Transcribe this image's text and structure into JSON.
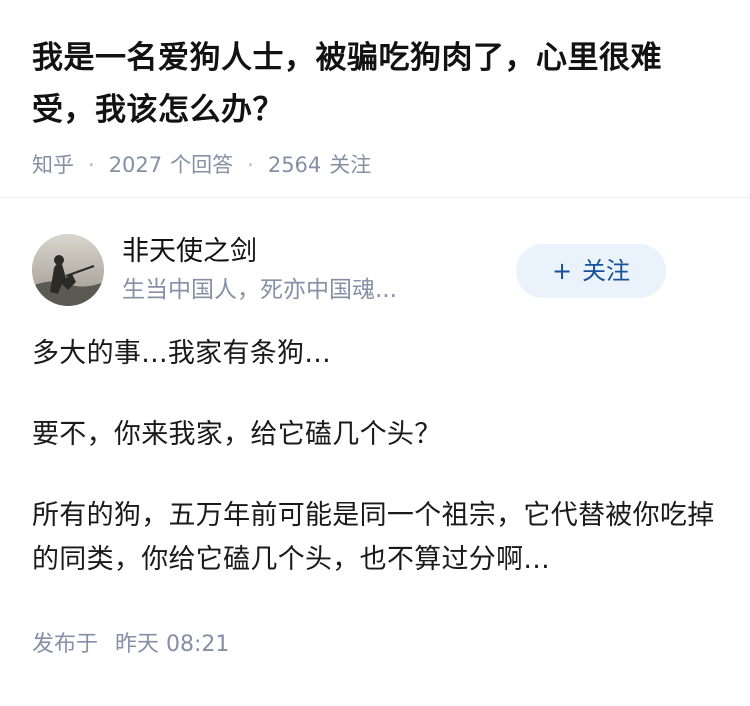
{
  "question": {
    "title": "我是一名爱狗人士，被骗吃狗肉了，心里很难受，我该怎么办？",
    "source": "知乎",
    "answers_count": "2027",
    "answers_label": "个回答",
    "followers_count": "2564",
    "followers_label": "关注",
    "separator": "·"
  },
  "answer": {
    "author": {
      "name": "非天使之剑",
      "bio": "生当中国人，死亦中国魂..."
    },
    "follow_button": {
      "plus": "+",
      "label": "关注"
    },
    "paragraphs": [
      "多大的事...我家有条狗...",
      "要不，你来我家，给它磕几个头？",
      "所有的狗，五万年前可能是同一个祖宗，它代替被你吃掉的同类，你给它磕几个头，也不算过分啊..."
    ],
    "publish_label": "发布于",
    "publish_time": "昨天 08:21"
  },
  "colors": {
    "meta_gray": "#8590a6",
    "follow_blue": "#175199",
    "follow_bg": "#eaf2fb"
  }
}
